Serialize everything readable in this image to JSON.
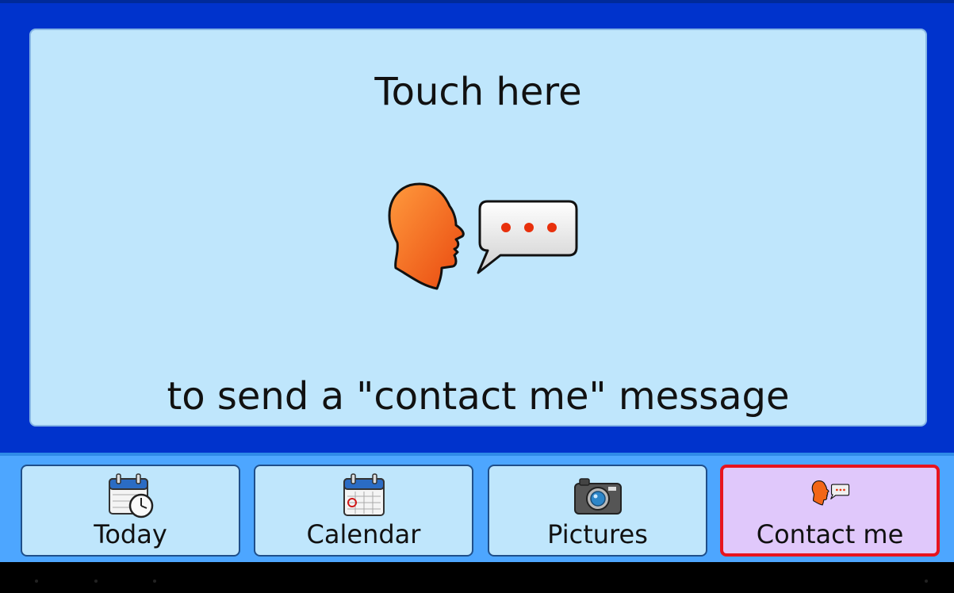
{
  "panel": {
    "title": "Touch here",
    "subtitle": "to send a \"contact me\" message",
    "icon": "speaking-head-message-icon"
  },
  "nav": {
    "items": [
      {
        "label": "Today",
        "icon": "calendar-clock-icon"
      },
      {
        "label": "Calendar",
        "icon": "calendar-icon"
      },
      {
        "label": "Pictures",
        "icon": "camera-icon"
      },
      {
        "label": "Contact me",
        "icon": "speaking-head-message-icon",
        "selected": true
      }
    ]
  },
  "colors": {
    "background": "#0033cc",
    "panel": "#bfe6fc",
    "bar": "#4da6ff",
    "selected_bg": "#e0c8fb",
    "selected_border": "#e8141e",
    "accent_orange": "#ff6a13"
  }
}
